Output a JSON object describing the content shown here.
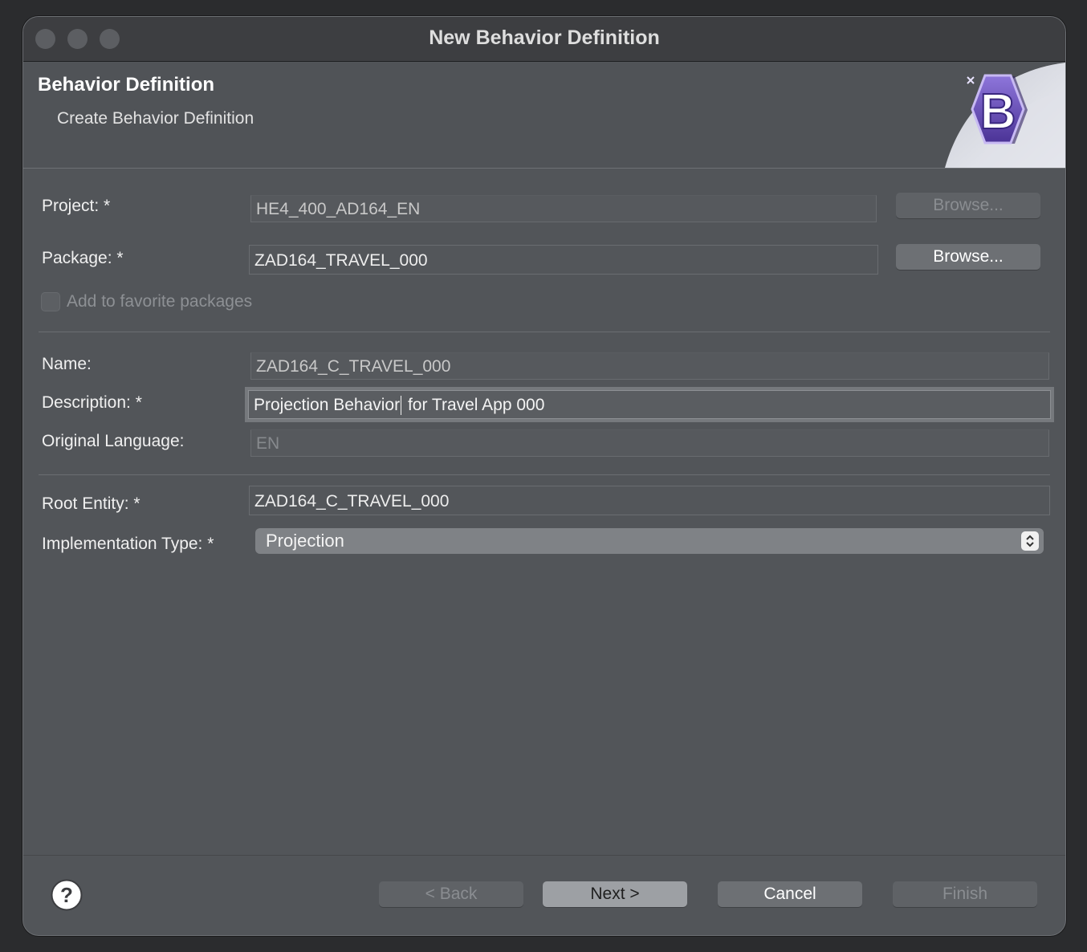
{
  "window": {
    "title": "New Behavior Definition"
  },
  "header": {
    "title": "Behavior Definition",
    "subtitle": "Create Behavior Definition",
    "banner_icon": "behavior-definition-b-icon"
  },
  "form": {
    "project": {
      "label": "Project: *",
      "value": "HE4_400_AD164_EN",
      "browse": "Browse..."
    },
    "package": {
      "label": "Package: *",
      "value": "ZAD164_TRAVEL_000",
      "browse": "Browse..."
    },
    "favorite": {
      "label": "Add to favorite packages",
      "checked": false
    },
    "name": {
      "label": "Name:",
      "value": "ZAD164_C_TRAVEL_000"
    },
    "description": {
      "label": "Description: *",
      "value_before_caret": "Projection Behavior",
      "value_after_caret": " for Travel App 000"
    },
    "language": {
      "label": "Original Language:",
      "value": "EN"
    },
    "root_entity": {
      "label": "Root Entity: *",
      "value": "ZAD164_C_TRAVEL_000"
    },
    "impl_type": {
      "label": "Implementation Type: *",
      "value": "Projection"
    }
  },
  "footer": {
    "back": "< Back",
    "next": "Next >",
    "cancel": "Cancel",
    "finish": "Finish",
    "help_icon": "help-icon"
  },
  "colors": {
    "background": "#525559",
    "titlebar": "#3d3e41",
    "accent_purple": "#6a4fb3"
  }
}
